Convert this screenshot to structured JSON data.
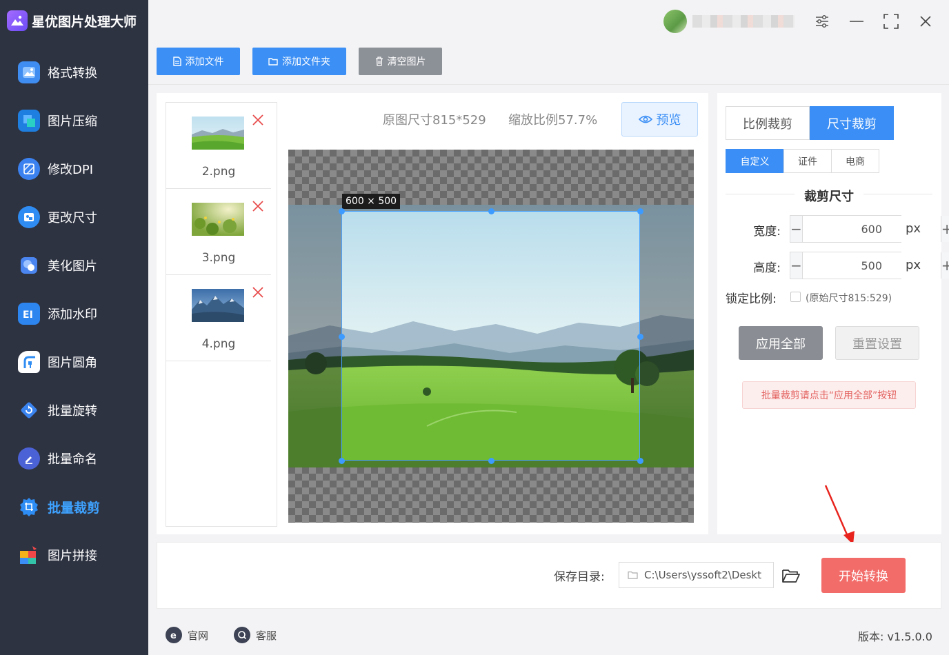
{
  "app": {
    "title": "星优图片处理大师"
  },
  "sidebar": {
    "items": [
      {
        "label": "格式转换",
        "icon": "format-convert-icon",
        "active": false
      },
      {
        "label": "图片压缩",
        "icon": "compress-icon",
        "active": false
      },
      {
        "label": "修改DPI",
        "icon": "dpi-icon",
        "active": false
      },
      {
        "label": "更改尺寸",
        "icon": "resize-icon",
        "active": false
      },
      {
        "label": "美化图片",
        "icon": "beautify-icon",
        "active": false
      },
      {
        "label": "添加水印",
        "icon": "watermark-icon",
        "active": false
      },
      {
        "label": "图片圆角",
        "icon": "rounded-corner-icon",
        "active": false
      },
      {
        "label": "批量旋转",
        "icon": "rotate-icon",
        "active": false
      },
      {
        "label": "批量命名",
        "icon": "rename-icon",
        "active": false
      },
      {
        "label": "批量裁剪",
        "icon": "crop-icon",
        "active": true
      },
      {
        "label": "图片拼接",
        "icon": "puzzle-icon",
        "active": false
      }
    ]
  },
  "toolbar": {
    "add_file": "添加文件",
    "add_folder": "添加文件夹",
    "clear_images": "清空图片"
  },
  "files": [
    {
      "name": "2.png"
    },
    {
      "name": "3.png"
    },
    {
      "name": "4.png"
    }
  ],
  "preview": {
    "original_size": "原图尺寸815*529",
    "zoom_ratio": "缩放比例57.7%",
    "preview_button": "预览",
    "crop_label": "600 × 500"
  },
  "crop_panel": {
    "mode_tabs": [
      {
        "label": "比例裁剪",
        "active": false
      },
      {
        "label": "尺寸裁剪",
        "active": true
      }
    ],
    "preset_tabs": [
      {
        "label": "自定义",
        "active": true
      },
      {
        "label": "证件",
        "active": false
      },
      {
        "label": "电商",
        "active": false
      }
    ],
    "section_title": "裁剪尺寸",
    "width_label": "宽度:",
    "width_value": "600",
    "height_label": "高度:",
    "height_value": "500",
    "unit": "px",
    "lock_label": "锁定比例:",
    "lock_hint": "(原始尺寸815:529)",
    "apply_all": "应用全部",
    "reset": "重置设置",
    "notice": "批量裁剪请点击“应用全部”按钮"
  },
  "output": {
    "save_label": "保存目录:",
    "save_path": "C:\\Users\\yssoft2\\Deskt",
    "start_button": "开始转换"
  },
  "footer": {
    "website": "官网",
    "support": "客服",
    "version": "版本: v1.5.0.0"
  },
  "colors": {
    "accent": "#3b8ff5",
    "sidebar_bg": "#2e3342",
    "active_nav": "#3ea2ff",
    "start_button": "#f26c69"
  }
}
